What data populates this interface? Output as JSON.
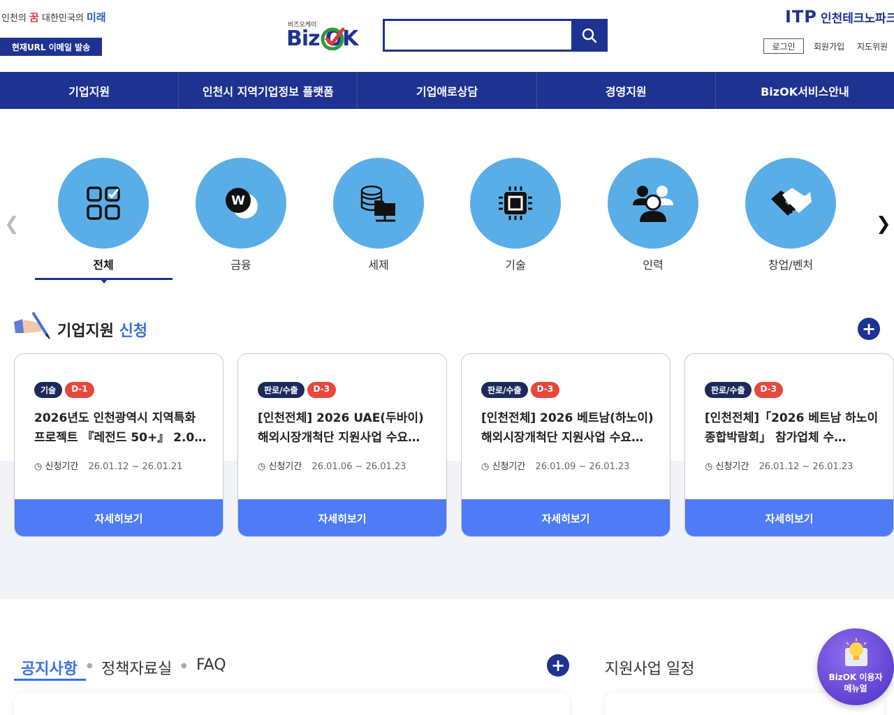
{
  "header": {
    "slogan_1": "인천의",
    "slogan_dream": "꿈",
    "slogan_2": "대한민국의",
    "slogan_future": "미래",
    "email_button": "현재URL 이메일 발송",
    "logo_sub": "비즈오케이",
    "logo_biz": "Biz",
    "logo_ok": "OK",
    "search_placeholder": "",
    "itp_logo": "ITP",
    "itp_name": "인천테크노파크",
    "login": "로그인",
    "signup": "회원가입",
    "mentor": "지도위원"
  },
  "gnb": [
    "기업지원",
    "인천시 지역기업정보 플랫폼",
    "기업애로상담",
    "경영지원",
    "BizOK서비스안내"
  ],
  "categories": [
    {
      "label": "전체",
      "icon": "grid-check-icon",
      "active": true
    },
    {
      "label": "금융",
      "icon": "won-coin-icon"
    },
    {
      "label": "세제",
      "icon": "database-folder-icon"
    },
    {
      "label": "기술",
      "icon": "chip-icon"
    },
    {
      "label": "인력",
      "icon": "people-icon"
    },
    {
      "label": "창업/벤처",
      "icon": "handshake-icon"
    }
  ],
  "support": {
    "title_main": "기업지원",
    "title_accent": "신청",
    "cards": [
      {
        "category": "기술",
        "dday": "D-1",
        "title": "2026년도 인천광역시 지역특화 프로젝트 『레전드 50+』 2.0…",
        "period_label": "신청기간",
        "period": "26.01.12 ~ 26.01.21",
        "button": "자세히보기"
      },
      {
        "category": "판로/수출",
        "dday": "D-3",
        "title": "[인천전체] 2026 UAE(두바이) 해외시장개척단 지원사업 수요…",
        "period_label": "신청기간",
        "period": "26.01.06 ~ 26.01.23",
        "button": "자세히보기"
      },
      {
        "category": "판로/수출",
        "dday": "D-3",
        "title": "[인천전체] 2026 베트남(하노이) 해외시장개척단 지원사업 수요…",
        "period_label": "신청기간",
        "period": "26.01.09 ~ 26.01.23",
        "button": "자세히보기"
      },
      {
        "category": "판로/수출",
        "dday": "D-3",
        "title": "[인천전체]「2026 베트남 하노이 종합박람회」 참가업체 수…",
        "period_label": "신청기간",
        "period": "26.01.12 ~ 26.01.23",
        "button": "자세히보기"
      }
    ]
  },
  "board": {
    "tab_notice": "공지사항",
    "tab_policy": "정책자료실",
    "tab_faq": "FAQ",
    "schedule_title": "지원사업 일정"
  },
  "manual_button": {
    "line1": "BizOK 이용자",
    "line2": "메뉴얼"
  },
  "colors": {
    "primary": "#1e3291",
    "accent": "#3b6fe0",
    "card_button": "#4f7cf6",
    "dday": "#e8473b",
    "category_circle": "#5aaee8"
  }
}
